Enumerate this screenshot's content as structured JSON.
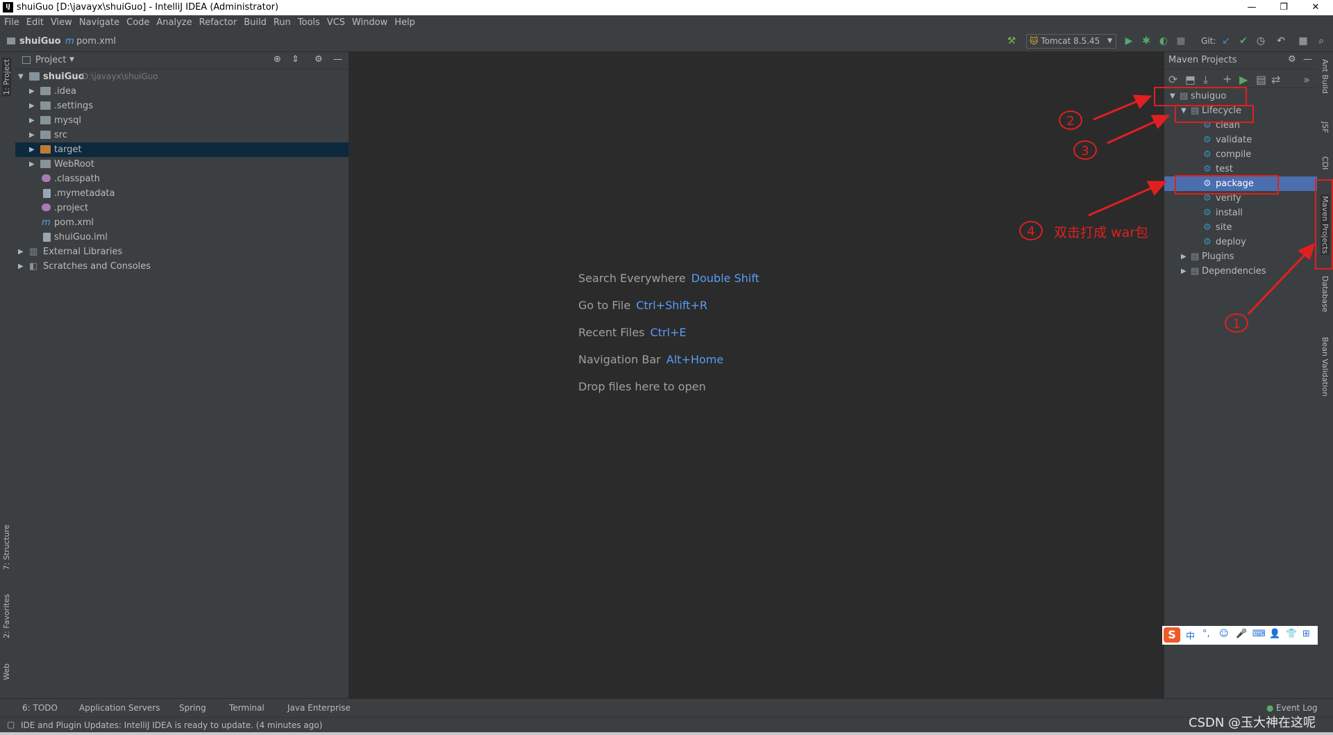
{
  "window": {
    "title": "shuiGuo [D:\\javayx\\shuiGuo] - IntelliJ IDEA (Administrator)",
    "app_icon": "IJ",
    "controls": {
      "minimize": "—",
      "restore": "❐",
      "close": "✕"
    }
  },
  "menu": [
    "File",
    "Edit",
    "View",
    "Navigate",
    "Code",
    "Analyze",
    "Refactor",
    "Build",
    "Run",
    "Tools",
    "VCS",
    "Window",
    "Help"
  ],
  "navbar": {
    "project": "shuiGuo",
    "file": "pom.xml",
    "run_config": "Tomcat 8.5.45",
    "git_label": "Git:"
  },
  "left_stripe": {
    "project_tab": "1: Project",
    "structure_tab": "7: Structure",
    "favorites_tab": "2: Favorites",
    "web_tab": "Web"
  },
  "project_panel": {
    "title": "Project",
    "root_name": "shuiGuo",
    "root_path": "D:\\javayx\\shuiGuo",
    "children": [
      ".idea",
      ".settings",
      "mysql",
      "src",
      "target",
      "WebRoot",
      ".classpath",
      ".mymetadata",
      ".project",
      "pom.xml",
      "shuiGuo.iml"
    ],
    "external_libraries": "External Libraries",
    "scratches": "Scratches and Consoles"
  },
  "editor_hints": [
    {
      "label": "Search Everywhere",
      "key": "Double Shift"
    },
    {
      "label": "Go to File",
      "key": "Ctrl+Shift+R"
    },
    {
      "label": "Recent Files",
      "key": "Ctrl+E"
    },
    {
      "label": "Navigation Bar",
      "key": "Alt+Home"
    },
    {
      "label": "Drop files here to open",
      "key": ""
    }
  ],
  "maven_panel": {
    "title": "Maven Projects",
    "project": "shuiguo",
    "lifecycle": "Lifecycle",
    "goals": [
      "clean",
      "validate",
      "compile",
      "test",
      "package",
      "verify",
      "install",
      "site",
      "deploy"
    ],
    "selected_goal": "package",
    "plugins": "Plugins",
    "dependencies": "Dependencies"
  },
  "right_stripe": [
    "Ant Build",
    "JSF",
    "CDI",
    "Maven Projects",
    "Database",
    "Bean Validation"
  ],
  "bottom_tabs": [
    "6: TODO",
    "Application Servers",
    "Spring",
    "Terminal",
    "Java Enterprise"
  ],
  "event_log": "Event Log",
  "status_message": "IDE and Plugin Updates: IntelliJ IDEA is ready to update. (4 minutes ago)",
  "annotations": {
    "one": "1",
    "two": "2",
    "three": "3",
    "four": "4",
    "four_text": "双击打成 war包"
  },
  "ime_bar": {
    "logo": "S",
    "items": [
      "中",
      "°,",
      "☺",
      "🎤",
      "⌨",
      "👤",
      "👕",
      "⊞"
    ]
  },
  "watermark": "CSDN @玉大神在这呢",
  "colors": {
    "accent": "#589df6",
    "selection": "#4b6eaf",
    "annotation": "#e02020"
  }
}
